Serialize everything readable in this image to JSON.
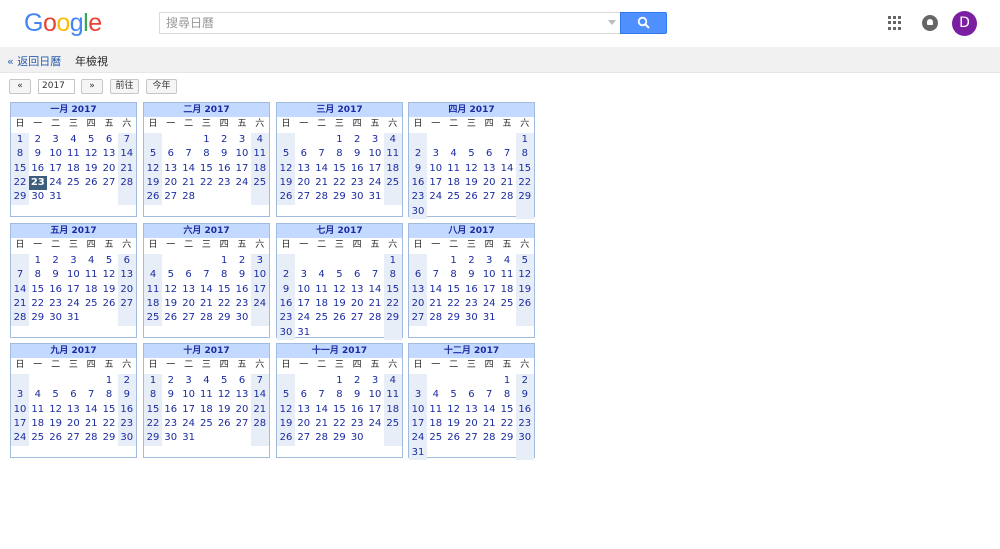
{
  "logo": {
    "text": "Google"
  },
  "search": {
    "placeholder": "搜尋日曆",
    "value": ""
  },
  "account": {
    "initial": "D"
  },
  "subnav": {
    "back": "« 返回日曆",
    "view": "年檢視"
  },
  "yearnav": {
    "prev": "«",
    "year": "2017",
    "next": "»",
    "go": "前往",
    "today": "今年"
  },
  "weekday_labels": [
    "日",
    "一",
    "二",
    "三",
    "四",
    "五",
    "六"
  ],
  "today_day": "23",
  "months": [
    {
      "title": "一月 2017",
      "start": 0,
      "days": 31,
      "today": 23
    },
    {
      "title": "二月 2017",
      "start": 3,
      "days": 28
    },
    {
      "title": "三月 2017",
      "start": 3,
      "days": 31
    },
    {
      "title": "四月 2017",
      "start": 6,
      "days": 30
    },
    {
      "title": "五月 2017",
      "start": 1,
      "days": 31
    },
    {
      "title": "六月 2017",
      "start": 4,
      "days": 30
    },
    {
      "title": "七月 2017",
      "start": 6,
      "days": 31
    },
    {
      "title": "八月 2017",
      "start": 2,
      "days": 31
    },
    {
      "title": "九月 2017",
      "start": 5,
      "days": 30
    },
    {
      "title": "十月 2017",
      "start": 0,
      "days": 31
    },
    {
      "title": "十一月 2017",
      "start": 3,
      "days": 30
    },
    {
      "title": "十二月 2017",
      "start": 5,
      "days": 31
    }
  ],
  "colors": {
    "header_bg": "#c3d9ff",
    "border": "#a2bbdd",
    "weekend": "#e8eef7",
    "link": "#1a2ba0",
    "today_bg": "#3d5d7d"
  }
}
